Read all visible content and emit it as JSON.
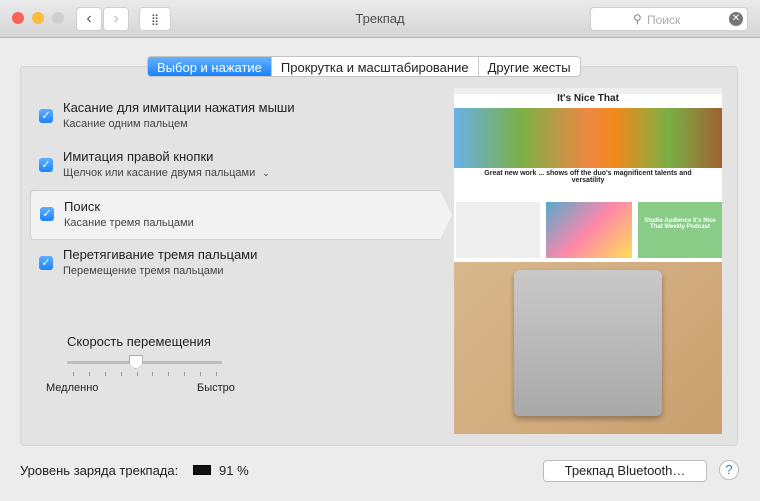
{
  "window": {
    "title": "Трекпад",
    "search_placeholder": "Поиск"
  },
  "tabs": [
    {
      "label": "Выбор и нажатие",
      "active": true
    },
    {
      "label": "Прокрутка и масштабирование",
      "active": false
    },
    {
      "label": "Другие жесты",
      "active": false
    }
  ],
  "options": [
    {
      "title": "Касание для имитации нажатия мыши",
      "subtitle": "Касание одним пальцем",
      "checked": true
    },
    {
      "title": "Имитация правой кнопки",
      "subtitle": "Щелчок или касание двумя пальцами",
      "checked": true
    },
    {
      "title": "Поиск",
      "subtitle": "Касание тремя пальцами",
      "checked": true
    },
    {
      "title": "Перетягивание тремя пальцами",
      "subtitle": "Перемещение тремя пальцами",
      "checked": true
    }
  ],
  "slider": {
    "label": "Скорость перемещения",
    "min_label": "Медленно",
    "max_label": "Быстро",
    "value": 0.44,
    "ticks": 10
  },
  "preview": {
    "site_title": "It's Nice That",
    "headline": "Great new work ... shows off the duo's magnificent talents and versatility",
    "podcast": "Studio Audience It's Nice That Weekly Podcast"
  },
  "footer": {
    "battery_label": "Уровень заряда трекпада:",
    "battery_value": "91 %",
    "bluetooth_button": "Трекпад Bluetooth…",
    "help": "?"
  },
  "colors": {
    "accent": "#1a82fb"
  }
}
